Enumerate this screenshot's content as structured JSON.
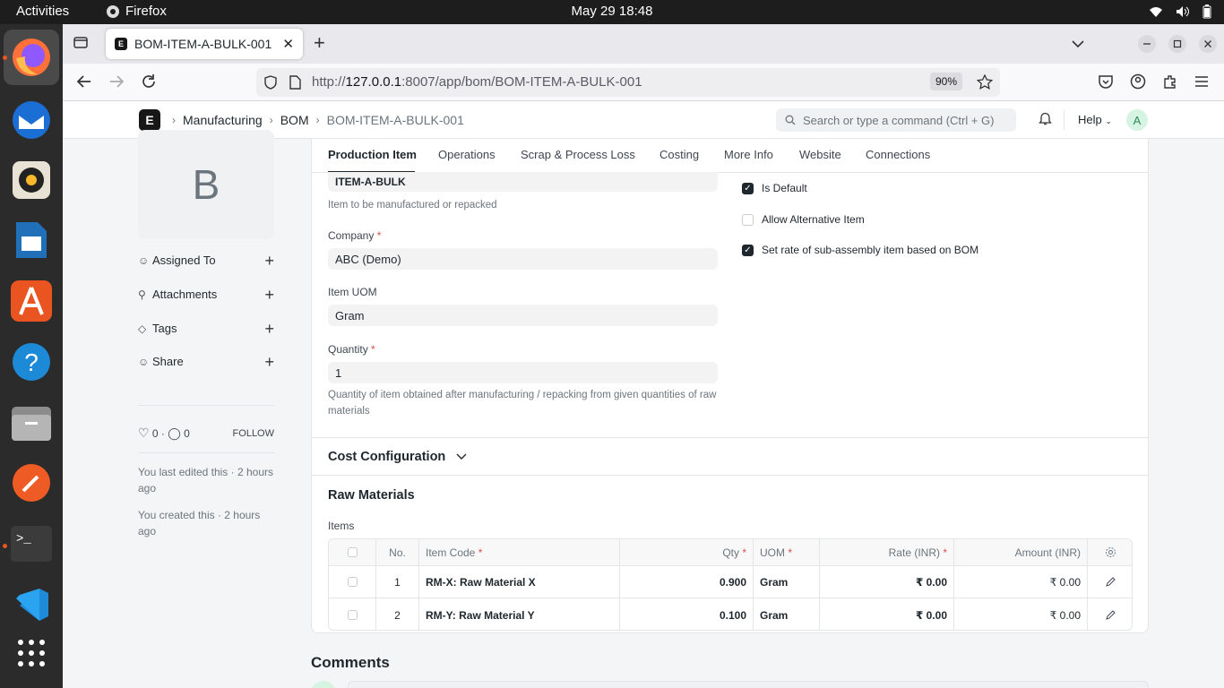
{
  "system": {
    "activities": "Activities",
    "app_name": "Firefox",
    "clock": "May 29  18:48"
  },
  "browser": {
    "tab_title": "BOM-ITEM-A-BULK-001",
    "url_prefix": "http://",
    "url_host": "127.0.0.1",
    "url_rest": ":8007/app/bom/BOM-ITEM-A-BULK-001",
    "zoom": "90%"
  },
  "appnav": {
    "logo": "E",
    "breadcrumbs": [
      "Manufacturing",
      "BOM",
      "BOM-ITEM-A-BULK-001"
    ],
    "search_placeholder": "Search or type a command (Ctrl + G)",
    "help": "Help",
    "avatar": "A"
  },
  "sidebar": {
    "avatar_letter": "B",
    "assigned_to": "Assigned To",
    "attachments": "Attachments",
    "tags": "Tags",
    "share": "Share",
    "likes": "0",
    "comments": "0",
    "follow": "FOLLOW",
    "edited": "You last edited this · 2 hours ago",
    "created": "You created this · 2 hours ago"
  },
  "form": {
    "tabs": [
      "Production Item",
      "Operations",
      "Scrap & Process Loss",
      "Costing",
      "More Info",
      "Website",
      "Connections"
    ],
    "item_value": "ITEM-A-BULK",
    "item_desc": "Item to be manufactured or repacked",
    "company_label": "Company",
    "company_value": "ABC (Demo)",
    "uom_label": "Item UOM",
    "uom_value": "Gram",
    "qty_label": "Quantity",
    "qty_value": "1",
    "qty_desc": "Quantity of item obtained after manufacturing / repacking from given quantities of raw materials",
    "required_mark": "*",
    "checks": [
      {
        "label": "Is Default",
        "checked": true
      },
      {
        "label": "Allow Alternative Item",
        "checked": false
      },
      {
        "label": "Set rate of sub-assembly item based on BOM",
        "checked": true
      }
    ],
    "cost_config": "Cost Configuration",
    "raw_materials": "Raw Materials",
    "items_label": "Items"
  },
  "items_table": {
    "headers": {
      "no": "No.",
      "item_code": "Item Code",
      "qty": "Qty",
      "uom": "UOM",
      "rate": "Rate (INR)",
      "amount": "Amount (INR)"
    },
    "rows": [
      {
        "no": "1",
        "item_code": "RM-X: Raw Material X",
        "qty": "0.900",
        "uom": "Gram",
        "rate": "₹ 0.00",
        "amount": "₹ 0.00"
      },
      {
        "no": "2",
        "item_code": "RM-Y: Raw Material Y",
        "qty": "0.100",
        "uom": "Gram",
        "rate": "₹ 0.00",
        "amount": "₹ 0.00"
      }
    ]
  },
  "comments_title": "Comments",
  "colors": {
    "accent": "#e95420",
    "dark": "#1f272e",
    "muted": "#6c757d"
  }
}
